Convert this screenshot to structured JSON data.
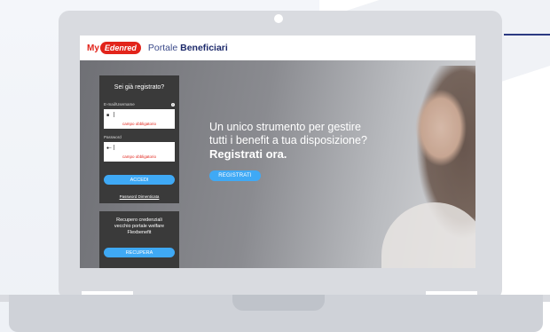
{
  "header": {
    "logo_my": "My",
    "logo_brand": "Edenred",
    "portal_prefix": "Portale",
    "portal_name": "Beneficiari"
  },
  "hero": {
    "line1": "Un unico strumento per gestire",
    "line2": "tutti i benefit a tua disposizione?",
    "cta_headline": "Registrati ora.",
    "register_button": "REGISTRATI"
  },
  "login": {
    "title": "Sei già registrato?",
    "email_label": "E-mail/Username",
    "password_label": "Password",
    "email_required": "campo obbligatorio",
    "password_required": "campo obbligatorio",
    "login_button": "ACCEDI",
    "forgot_link": "Password Dimenticata"
  },
  "recovery": {
    "line1": "Recupero credenziali",
    "line2": "vecchio portale welfare",
    "line3": "Flexbenefit",
    "button": "RECUPERA"
  },
  "colors": {
    "brand_red": "#e2241b",
    "accent_blue": "#3fa9f5",
    "panel_dark": "#3a3a3a",
    "navy": "#1d2a6b"
  }
}
